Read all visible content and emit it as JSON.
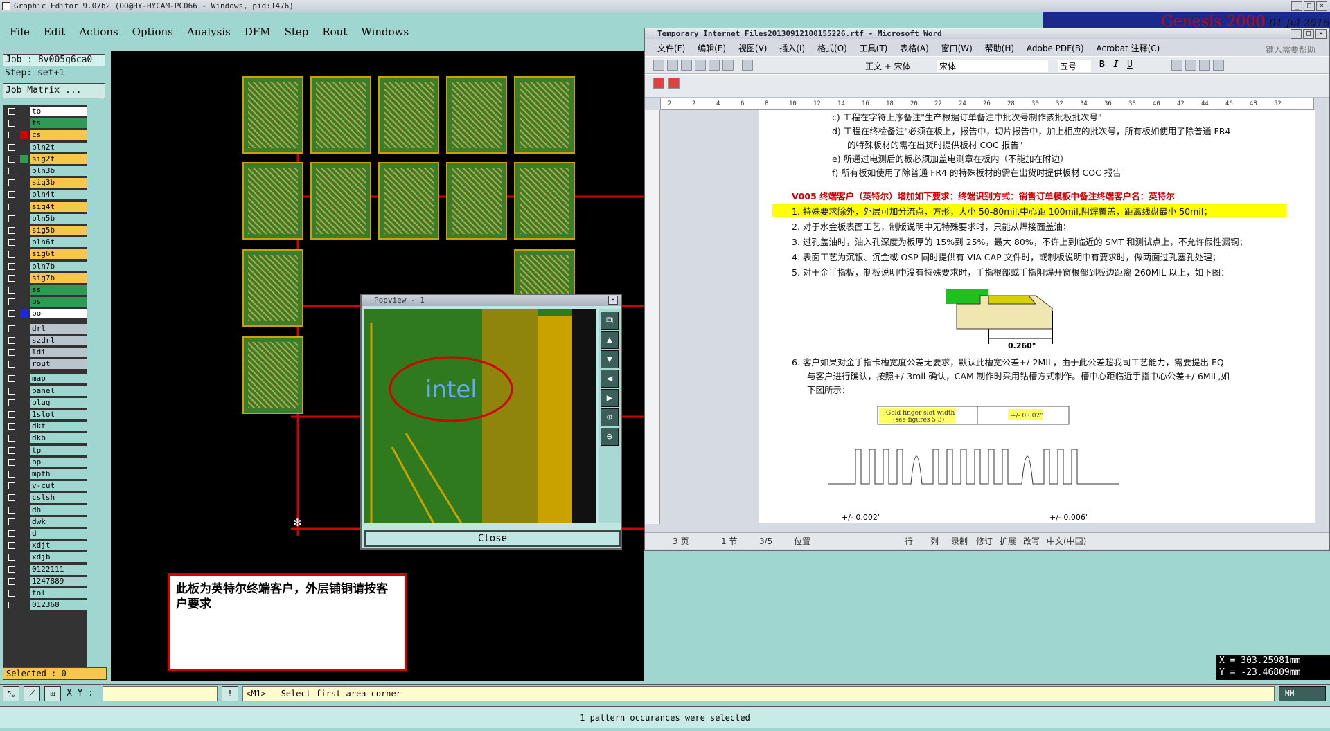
{
  "app": {
    "title": "Graphic Editor 9.07b2 (OO@HY-HYCAM-PC066 - Windows, pid:1476)"
  },
  "menu": [
    "File",
    "Edit",
    "Actions",
    "Options",
    "Analysis",
    "DFM",
    "Step",
    "Rout",
    "Windows"
  ],
  "genesis": {
    "brand": "Genesis 2000",
    "date": "01 Jul 2016"
  },
  "job": {
    "job": "Job : 8v005g6ca0",
    "step": "Step: set+1",
    "matrix_button": "Job Matrix ..."
  },
  "layers": [
    {
      "name": "to",
      "color": "#ffffff"
    },
    {
      "name": "ts",
      "color": "#2e9a53"
    },
    {
      "name": "cs",
      "color": "#f7c64a",
      "swatch": "#d40000"
    },
    {
      "name": "pln2t",
      "color": "#9fd6d0"
    },
    {
      "name": "sig2t",
      "color": "#f7c64a",
      "swatch": "#2e9a53"
    },
    {
      "name": "pln3b",
      "color": "#9fd6d0"
    },
    {
      "name": "sig3b",
      "color": "#f7c64a"
    },
    {
      "name": "pln4t",
      "color": "#9fd6d0"
    },
    {
      "name": "sig4t",
      "color": "#f7c64a"
    },
    {
      "name": "pln5b",
      "color": "#9fd6d0"
    },
    {
      "name": "sig5b",
      "color": "#f7c64a"
    },
    {
      "name": "pln6t",
      "color": "#9fd6d0"
    },
    {
      "name": "sig6t",
      "color": "#f7c64a"
    },
    {
      "name": "pln7b",
      "color": "#9fd6d0"
    },
    {
      "name": "sig7b",
      "color": "#f7c64a"
    },
    {
      "name": "ss",
      "color": "#2e9a53"
    },
    {
      "name": "bs",
      "color": "#2e9a53"
    },
    {
      "name": "bo",
      "color": "#ffffff",
      "swatch": "#1a2ad8"
    },
    {
      "name": "drl",
      "color": "#b9c4cc"
    },
    {
      "name": "szdrl",
      "color": "#b9c4cc"
    },
    {
      "name": "ldi",
      "color": "#b9c4cc"
    },
    {
      "name": "rout",
      "color": "#b9c4cc"
    },
    {
      "name": "map",
      "color": "#9fd6d0"
    },
    {
      "name": "panel",
      "color": "#9fd6d0"
    },
    {
      "name": "plug",
      "color": "#9fd6d0"
    },
    {
      "name": "1slot",
      "color": "#9fd6d0"
    },
    {
      "name": "dkt",
      "color": "#9fd6d0"
    },
    {
      "name": "dkb",
      "color": "#9fd6d0"
    },
    {
      "name": "tp",
      "color": "#9fd6d0"
    },
    {
      "name": "bp",
      "color": "#9fd6d0"
    },
    {
      "name": "mpth",
      "color": "#9fd6d0"
    },
    {
      "name": "v-cut",
      "color": "#9fd6d0"
    },
    {
      "name": "cslsh",
      "color": "#9fd6d0"
    },
    {
      "name": "dh",
      "color": "#9fd6d0"
    },
    {
      "name": "dwk",
      "color": "#9fd6d0"
    },
    {
      "name": "d",
      "color": "#9fd6d0"
    },
    {
      "name": "xdjt",
      "color": "#9fd6d0"
    },
    {
      "name": "xdjb",
      "color": "#9fd6d0"
    },
    {
      "name": "0122111",
      "color": "#9fd6d0"
    },
    {
      "name": "1247889",
      "color": "#9fd6d0"
    },
    {
      "name": "tol",
      "color": "#9fd6d0"
    },
    {
      "name": "012368",
      "color": "#9fd6d0"
    }
  ],
  "selected": "Selected : 0",
  "popview": {
    "title": "Popview - 1",
    "close_label": "Close"
  },
  "note": {
    "text": "此板为英特尔终端客户，外层铺铜请按客户要求"
  },
  "word": {
    "title": "Temporary Internet Files20130912100155226.rtf - Microsoft Word",
    "menu": [
      "文件(F)",
      "编辑(E)",
      "视图(V)",
      "插入(I)",
      "格式(O)",
      "工具(T)",
      "表格(A)",
      "窗口(W)",
      "帮助(H)",
      "Adobe PDF(B)",
      "Acrobat 注释(C)"
    ],
    "help_placeholder": "键入需要帮助",
    "style": "正文 + 宋体",
    "font": "宋体",
    "size": "五号",
    "ruler": [
      "2",
      "2",
      "4",
      "6",
      "8",
      "10",
      "12",
      "14",
      "16",
      "18",
      "20",
      "22",
      "24",
      "26",
      "28",
      "30",
      "32",
      "34",
      "36",
      "38",
      "40",
      "42",
      "44",
      "46",
      "48",
      "52"
    ],
    "lines": {
      "c": "c)  工程在字符上序备注\"生产根据订单备注中批次号制作该批板批次号\"",
      "d1": "d)  工程在终检备注\"必须在板上，报告中，切片报告中，加上相应的批次号，所有板如使用了除普通 FR4",
      "d2": "的特殊板材的需在出货时提供板材 COC 报告\"",
      "e": "e)  所通过电测后的板必须加盖电测章在板内（不能加在附边）",
      "f": "f)  所有板如使用了除普通 FR4 的特殊板材的需在出货时提供板材 COC 报告",
      "heading": "V005 终端客户（英特尔）增加如下要求：终端识别方式：销售订单模板中备注终端客户名：英特尔",
      "item1": "1.   特殊要求除外，外层可加分流点，方形，大小 50-80mil,中心距 100mil,阻焊覆盖，距离线盘最小 50mil；",
      "item2": "2.   对于水金板表面工艺，制版说明中无特殊要求时，只能从焊接面盖油；",
      "item3": "3.   过孔盖油时，油入孔深度为板厚的 15%到 25%，最大 80%，不许上到临近的 SMT 和测试点上，不允许假性漏铜；",
      "item4": "4.   表面工艺为沉银、沉金或 OSP 同时提供有 VIA CAP 文件时，或制板说明中有要求时，做两面过孔塞孔处理；",
      "item5": "5.   对于金手指板，制板说明中没有特殊要求时，手指根部或手指阻焊开窗根部到板边距离 260MIL 以上，如下图：",
      "fig1_label": "0.260\"",
      "item6a": "6.   客户如果对金手指卡槽宽度公差无要求，默认此槽宽公差+/-2MIL，由于此公差超我司工艺能力，需要提出 EQ",
      "item6b": "与客户进行确认，按照+/-3mil 确认，CAM 制作时采用钻槽方式制作。槽中心距临近手指中心公差+/-6MIL,如",
      "item6c": "下图所示：",
      "fig2_label1": "Gold finger slot width",
      "fig2_label2": "(see figures 5.3)",
      "fig2_tol": "+/- 0.002\"",
      "fig2_bottom1": "+/- 0.002\"",
      "fig2_bottom2": "+/- 0.006\""
    },
    "status": {
      "page": "3 页",
      "section": "1 节",
      "pages": "3/5",
      "pos": "位置",
      "line": "行",
      "col": "列",
      "rec": "录制",
      "trk": "修订",
      "ext": "扩展",
      "ovr": "改写",
      "lang": "中文(中国)"
    }
  },
  "coords": {
    "x": "X = 303.25981mm",
    "y": "Y = -23.46809mm"
  },
  "bottom": {
    "xy_label": "X Y :",
    "message": "<M1> - Select first area corner",
    "units": "MM"
  },
  "statusline": "1 pattern occurances were selected"
}
